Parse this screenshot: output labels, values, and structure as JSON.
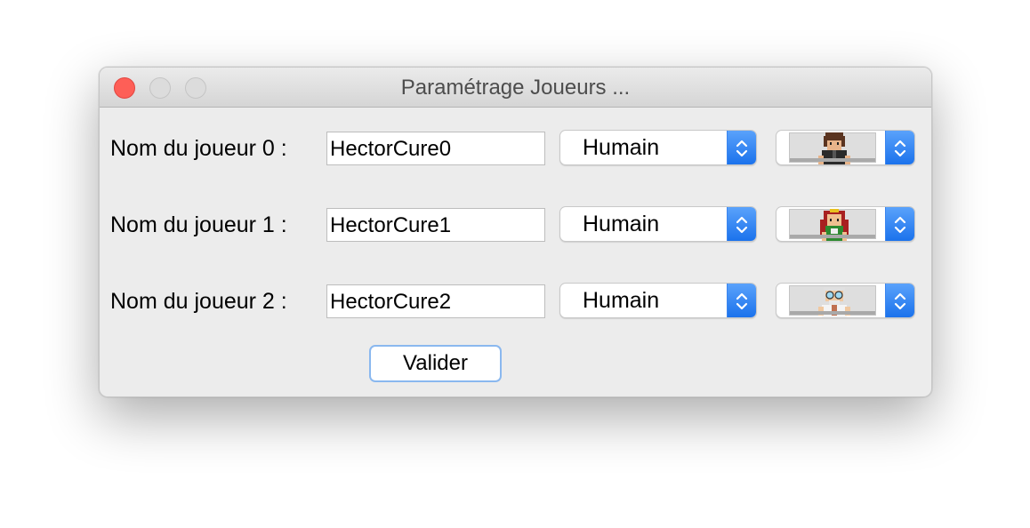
{
  "window": {
    "title": "Paramétrage Joueurs ..."
  },
  "players": [
    {
      "label": "Nom du joueur 0 :",
      "name": "HectorCure0",
      "type": "Humain",
      "avatar": "brown-haired-boy-avatar"
    },
    {
      "label": "Nom du joueur 1 :",
      "name": "HectorCure1",
      "type": "Humain",
      "avatar": "red-haired-girl-avatar"
    },
    {
      "label": "Nom du joueur 2 :",
      "name": "HectorCure2",
      "type": "Humain",
      "avatar": "old-scientist-avatar"
    }
  ],
  "actions": {
    "validate_label": "Valider"
  },
  "colors": {
    "close": "#fe5f57",
    "stepper": "#1b72ec",
    "focus_ring": "#8ab8ef"
  }
}
